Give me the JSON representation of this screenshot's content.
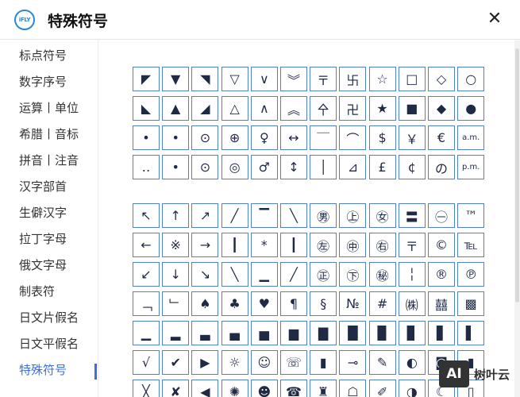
{
  "header": {
    "logo_text": "iFLY",
    "title": "特殊符号",
    "close_label": "✕"
  },
  "sidebar": {
    "items": [
      {
        "label": "标点符号",
        "active": false
      },
      {
        "label": "数字序号",
        "active": false
      },
      {
        "label": "运算丨单位",
        "active": false
      },
      {
        "label": "希腊丨音标",
        "active": false
      },
      {
        "label": "拼音丨注音",
        "active": false
      },
      {
        "label": "汉字部首",
        "active": false
      },
      {
        "label": "生僻汉字",
        "active": false
      },
      {
        "label": "拉丁字母",
        "active": false
      },
      {
        "label": "俄文字母",
        "active": false
      },
      {
        "label": "制表符",
        "active": false
      },
      {
        "label": "日文片假名",
        "active": false
      },
      {
        "label": "日文平假名",
        "active": false
      },
      {
        "label": "特殊符号",
        "active": true
      }
    ]
  },
  "groups": [
    {
      "rows": [
        [
          "◤",
          "▼",
          "◥",
          "▽",
          "∨",
          "︾",
          "〒",
          "卐",
          "☆",
          "□",
          "◇",
          "○"
        ],
        [
          "◣",
          "▲",
          "◢",
          "△",
          "∧",
          "︽",
          "㐃",
          "卍",
          "★",
          "■",
          "◆",
          "●"
        ],
        [
          "•",
          "•",
          "⊙",
          "⊕",
          "♀",
          "↔",
          "￣",
          "⌒",
          "$",
          "￥",
          "€",
          "a.m."
        ],
        [
          "‥",
          "•",
          "⊙",
          "◎",
          "♂",
          "↕",
          "│",
          "⊿",
          "£",
          "¢",
          "の",
          "p.m."
        ]
      ]
    },
    {
      "rows": [
        [
          "↖",
          "↑",
          "↗",
          "╱",
          "▔",
          "╲",
          "㊚",
          "㊤",
          "㊛",
          "〓",
          "㊀",
          "™"
        ],
        [
          "←",
          "※",
          "→",
          "┃",
          "*",
          "┃",
          "㊧",
          "㊥",
          "㊨",
          "〒",
          "©",
          "℡"
        ],
        [
          "↙",
          "↓",
          "↘",
          "╲",
          "▁",
          "╱",
          "㊣",
          "㊦",
          "㊙",
          "╎",
          "®",
          "℗"
        ],
        [
          "﹁",
          "﹂",
          "♠",
          "♣",
          "♥",
          "¶",
          "§",
          "№",
          "#",
          "㈱",
          "囍",
          "▩"
        ],
        [
          "▁",
          "▂",
          "▃",
          "▄",
          "▅",
          "▆",
          "▇",
          "█",
          "▉",
          "▊",
          "▋",
          "▌"
        ],
        [
          "√",
          "✔",
          "▶",
          "☼",
          "☺",
          "☏",
          "▮",
          "⊸",
          "✎",
          "◐",
          "◙",
          "▮"
        ],
        [
          "╳",
          "✘",
          "◀",
          "✺",
          "☻",
          "☎",
          "♜",
          "☖",
          "✐",
          "◑",
          "☾",
          "▯"
        ]
      ]
    }
  ],
  "watermark": {
    "badge": "AI",
    "text": "树叶云"
  }
}
